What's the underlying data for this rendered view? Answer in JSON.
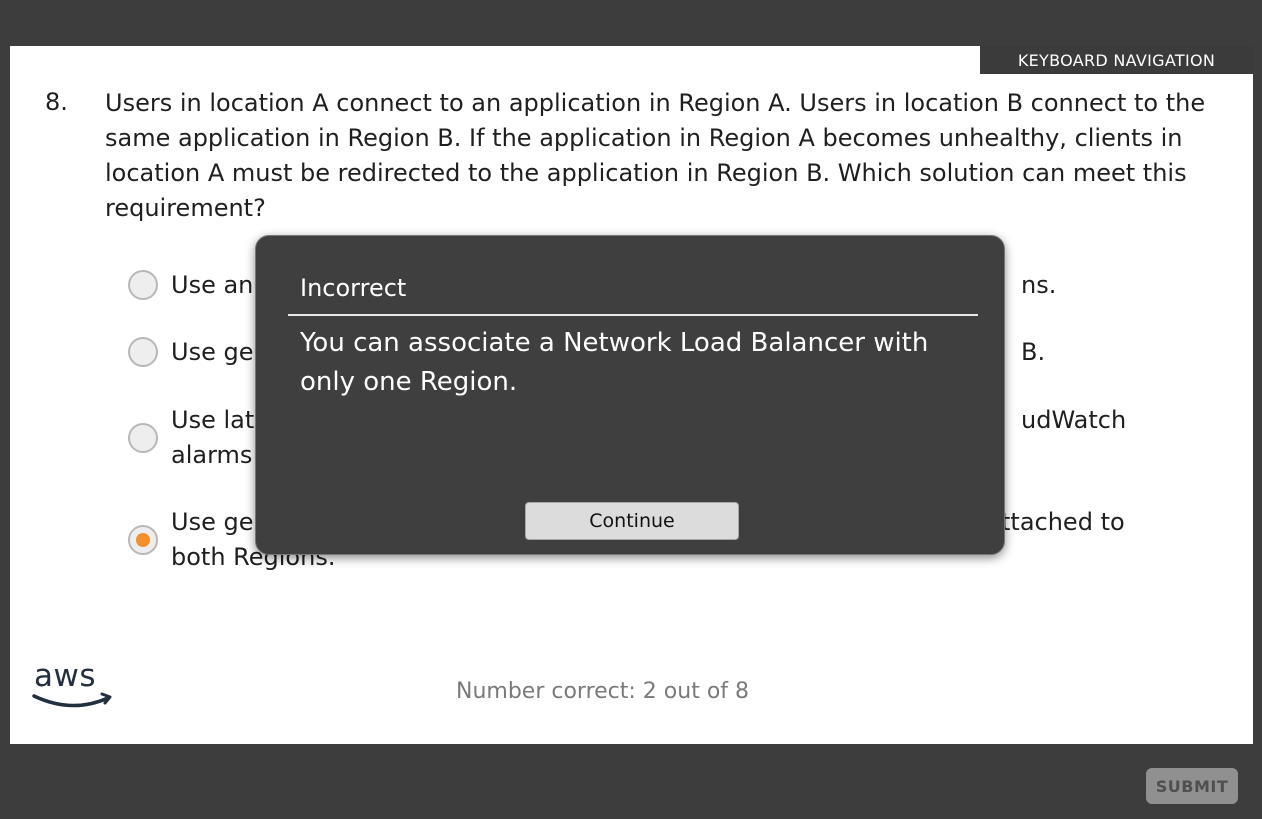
{
  "header": {
    "keyboard_navigation": "KEYBOARD NAVIGATION"
  },
  "question": {
    "number": "8.",
    "text": "Users in location A connect to an application in Region A. Users in location B connect to the same application in Region B. If the application in Region A becomes unhealthy, clients in location A must be redirected to the application in Region B. Which solution can meet this requirement?"
  },
  "options": [
    {
      "visible_start": "Use an",
      "visible_end": "ns.",
      "selected": false
    },
    {
      "visible_start": "Use ge",
      "visible_end": "B.",
      "selected": false
    },
    {
      "visible_start": "Use lat",
      "visible_end": "udWatch",
      "visible_line2": "alarms",
      "selected": false
    },
    {
      "visible_start": "Use ge",
      "visible_end": "ttached to",
      "visible_line2": "both Regions.",
      "selected": true
    }
  ],
  "footer": {
    "logo_text": "aws",
    "score_text": "Number correct: 2 out of 8",
    "submit_label": "SUBMIT"
  },
  "modal": {
    "title": "Incorrect",
    "body": "You can associate a Network Load Balancer with only one Region.",
    "continue_label": "Continue"
  },
  "colors": {
    "accent_orange": "#f58f2d",
    "frame": "#3d3d3d",
    "modal": "#3f3f3f"
  },
  "icons": [
    "radio-icon",
    "aws-logo-icon"
  ]
}
